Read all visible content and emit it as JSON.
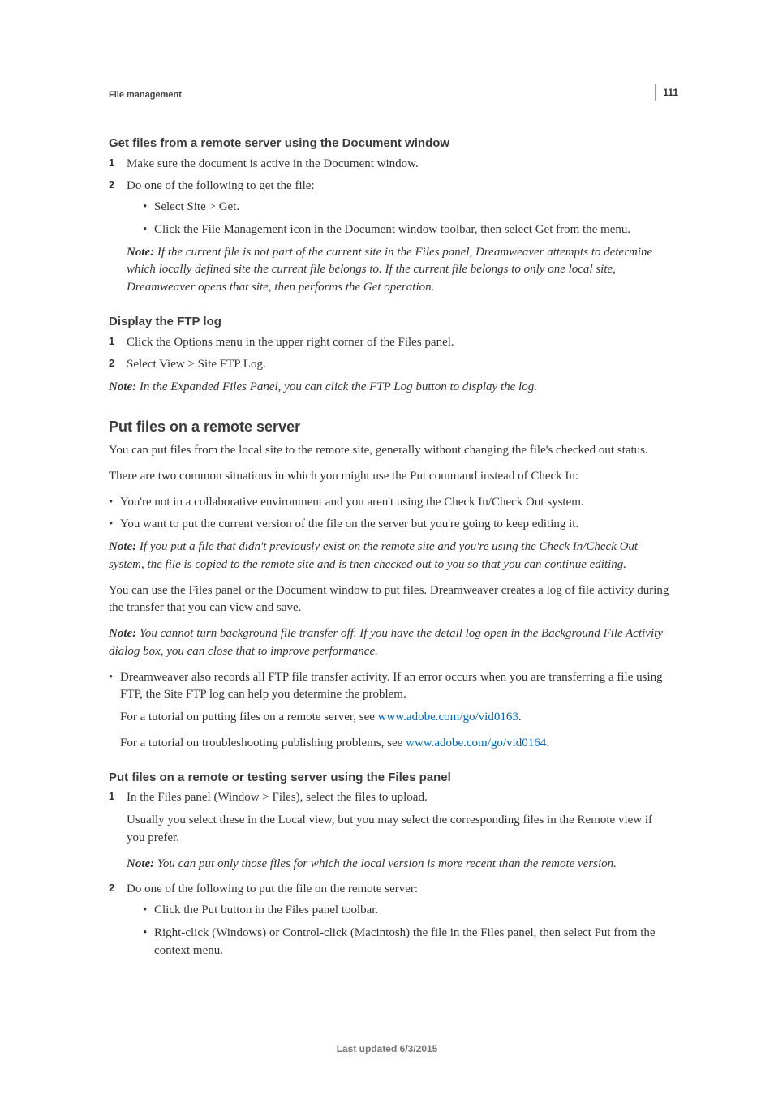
{
  "pageNumber": "111",
  "runningHead": "File management",
  "footer": "Last updated 6/3/2015",
  "section1": {
    "heading": "Get files from a remote server using the Document window",
    "step1": "Make sure the document is active in the Document window.",
    "step2": "Do one of the following to get the file:",
    "bullet1": "Select Site > Get.",
    "bullet2": "Click the File Management icon in the Document window toolbar, then select Get from the menu.",
    "noteLabel": "Note:",
    "noteBody": " If the current file is not part of the current site in the Files panel, Dreamweaver attempts to determine which locally defined site the current file belongs to. If the current file belongs to only one local site, Dreamweaver opens that site, then performs the Get operation."
  },
  "section2": {
    "heading": "Display the FTP log",
    "step1": "Click the Options menu in the upper right corner of the Files panel.",
    "step2": "Select View > Site FTP Log.",
    "noteLabel": "Note:",
    "noteBody": " In the Expanded Files Panel, you can click the FTP Log button to display the log."
  },
  "section3": {
    "heading": "Put files on a remote server",
    "intro1": "You can put files from the local site to the remote site, generally without changing the file's checked out status.",
    "intro2": "There are two common situations in which you might use the Put command instead of Check In:",
    "bullet1": "You're not in a collaborative environment and you aren't using the Check In/Check Out system.",
    "bullet2": "You want to put the current version of the file on the server but you're going to keep editing it.",
    "note1Label": "Note:",
    "note1Body": "  If you put a file that didn't previously exist on the remote site and you're using the Check In/Check Out system, the file is copied to the remote site and is then checked out to you so that you can continue editing.",
    "para2": "You can use the Files panel or the Document window to put files. Dreamweaver creates a log of file activity during the transfer that you can view and save.",
    "note2Label": "Note:",
    "note2Body": " You cannot turn background file transfer off. If you have the detail log open in the Background File Activity dialog box, you can close that to improve performance.",
    "b3a": "Dreamweaver also records all FTP file transfer activity. If an error occurs when you are transferring a file using FTP, the Site FTP log can help you determine the problem.",
    "b3b_pre": "For a tutorial on putting files on a remote server, see ",
    "b3b_link": "www.adobe.com/go/vid0163",
    "b3b_post": ".",
    "b3c_pre": "For a tutorial on troubleshooting publishing problems, see ",
    "b3c_link": "www.adobe.com/go/vid0164",
    "b3c_post": "."
  },
  "section4": {
    "heading": "Put files on a remote or testing server using the Files panel",
    "step1a": "In the Files panel (Window > Files), select the files to upload.",
    "step1b": "Usually you select these in the Local view, but you may select the corresponding files in the Remote view if you prefer.",
    "step1noteLabel": "Note:",
    "step1noteBody": " You can put only those files for which the local version is more recent than the remote version.",
    "step2": "Do one of the following to put the file on the remote server:",
    "bullet1": "Click the Put button in the Files panel toolbar.",
    "bullet2": "Right-click (Windows) or Control-click (Macintosh) the file in the Files panel, then select Put from the context menu."
  }
}
